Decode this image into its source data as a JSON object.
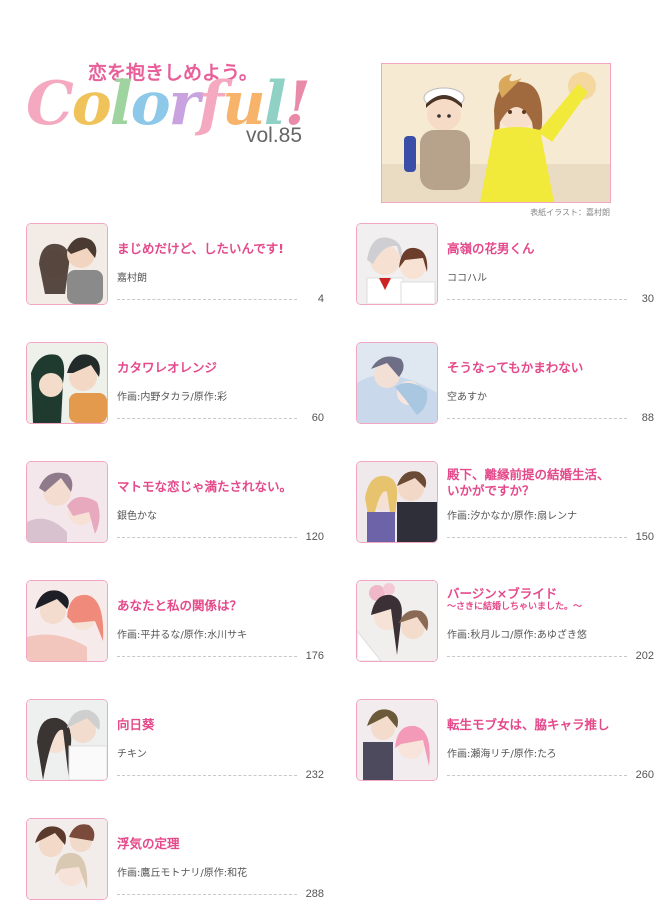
{
  "header": {
    "logo_sub": "恋を抱きしめよう。",
    "logo_main": "Colorful!",
    "logo_main_colors": [
      "#f4a9c0",
      "#f0c35a",
      "#9fd3a0",
      "#8ec8e8",
      "#c9a3e0",
      "#f4a9c0",
      "#f7b36a",
      "#8fd1c5",
      "#e98aa8"
    ],
    "volume": "vol.85",
    "cover_credit": "表紙イラスト：嘉村朗"
  },
  "colors": {
    "accent": "#e44a8b",
    "border": "#f2a6c4"
  },
  "entries": [
    {
      "title": "まじめだけど、したいんです!",
      "author": "嘉村朗",
      "page": "4"
    },
    {
      "title": "高嶺の花男くん",
      "author": "ココハル",
      "page": "30"
    },
    {
      "title": "カタワレオレンジ",
      "author": "作画:内野タカラ/原作:彩",
      "page": "60"
    },
    {
      "title": "そうなってもかまわない",
      "author": "空あすか",
      "page": "88"
    },
    {
      "title": "マトモな恋じゃ満たされない。",
      "author": "銀色かな",
      "page": "120"
    },
    {
      "title_line1": "殿下、離縁前提の結婚生活、",
      "title_line2": "いかがですか？",
      "author": "作画:汐かなか/原作:扇レンナ",
      "page": "150"
    },
    {
      "title": "あなたと私の関係は？",
      "author": "作画:平井るな/原作:水川サキ",
      "page": "176"
    },
    {
      "title_line1": "バージン×ブライド",
      "subtitle": "〜さきに結婚しちゃいました。〜",
      "author": "作画:秋月ルコ/原作:あゆざき悠",
      "page": "202"
    },
    {
      "title": "向日葵",
      "author": "チキン",
      "page": "232"
    },
    {
      "title": "転生モブ女は、脇キャラ推し",
      "author": "作画:瀬海リチ/原作:たろ",
      "page": "260"
    },
    {
      "title": "浮気の定理",
      "author": "作画:鷹丘モトナリ/原作:和花",
      "page": "288"
    }
  ]
}
